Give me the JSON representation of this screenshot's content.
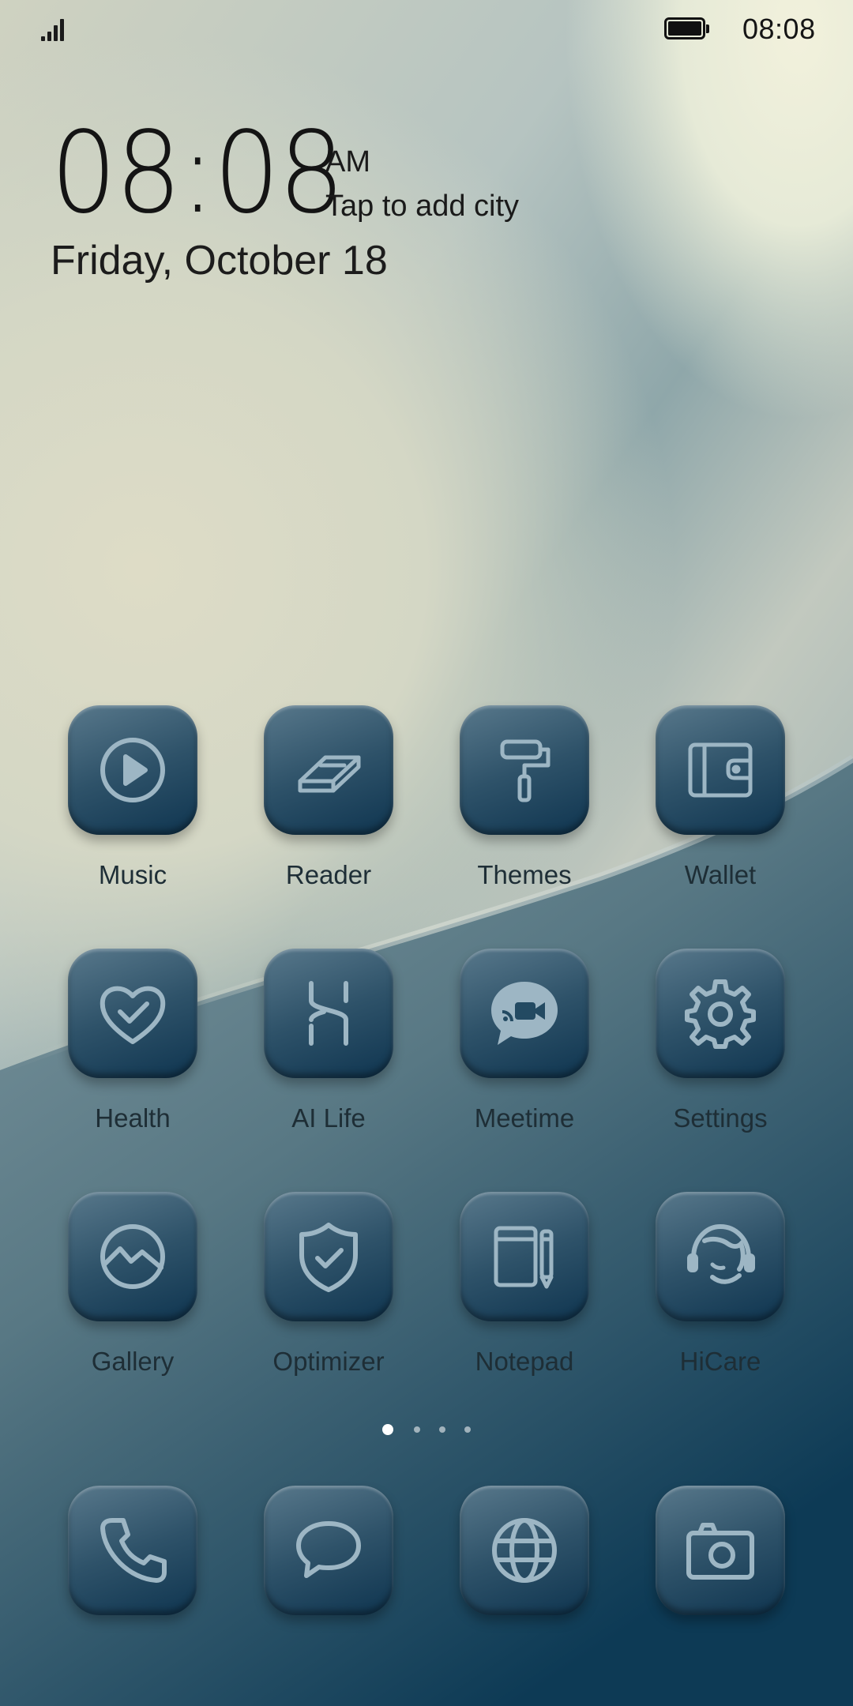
{
  "status_bar": {
    "time": "08:08",
    "icons": [
      "signal-icon",
      "battery-icon"
    ]
  },
  "clock_widget": {
    "time": "08:08",
    "ampm": "AM",
    "city_prompt": "Tap to add city",
    "date": "Friday, October 18"
  },
  "apps": [
    {
      "label": "Music",
      "icon": "play-icon"
    },
    {
      "label": "Reader",
      "icon": "book-icon"
    },
    {
      "label": "Themes",
      "icon": "paint-roller-icon"
    },
    {
      "label": "Wallet",
      "icon": "wallet-icon"
    },
    {
      "label": "Health",
      "icon": "heart-check-icon"
    },
    {
      "label": "AI Life",
      "icon": "ai-life-icon"
    },
    {
      "label": "Meetime",
      "icon": "video-chat-icon"
    },
    {
      "label": "Settings",
      "icon": "gear-icon"
    },
    {
      "label": "Gallery",
      "icon": "gallery-icon"
    },
    {
      "label": "Optimizer",
      "icon": "shield-check-icon"
    },
    {
      "label": "Notepad",
      "icon": "notepad-icon"
    },
    {
      "label": "HiCare",
      "icon": "headset-icon"
    }
  ],
  "page_indicator": {
    "pages": 4,
    "current": 1
  },
  "dock": [
    {
      "icon": "phone-icon"
    },
    {
      "icon": "message-icon"
    },
    {
      "icon": "globe-icon"
    },
    {
      "icon": "camera-icon"
    }
  ],
  "colors": {
    "tile_top": "#58788b",
    "tile_bottom": "#0f3550",
    "icon_stroke": "#9db6c4",
    "label_text": "#1e2e36"
  }
}
